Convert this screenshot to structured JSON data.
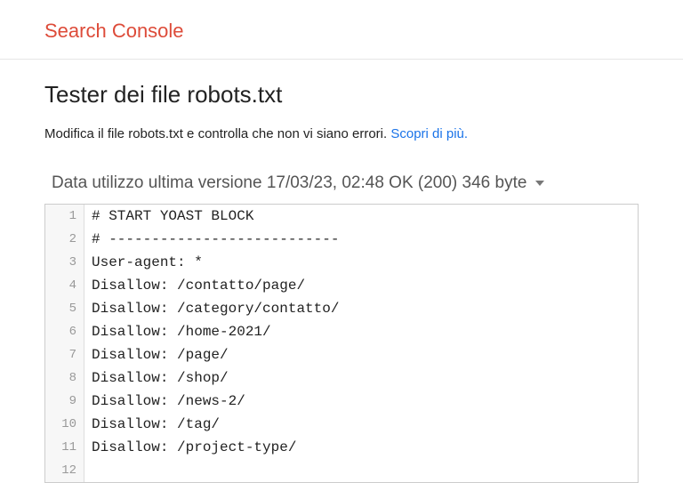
{
  "header": {
    "title": "Search Console"
  },
  "page": {
    "title": "Tester dei file robots.txt",
    "subtitle": "Modifica il file robots.txt e controlla che non vi siano errori. ",
    "learn_more": "Scopri di più."
  },
  "status": {
    "text": "Data utilizzo ultima versione 17/03/23, 02:48 OK (200) 346 byte"
  },
  "editor": {
    "lines": [
      "# START YOAST BLOCK",
      "# ---------------------------",
      "User-agent: *",
      "Disallow: /contatto/page/",
      "Disallow: /category/contatto/",
      "Disallow: /home-2021/",
      "Disallow: /page/",
      "Disallow: /shop/",
      "Disallow: /news-2/",
      "Disallow: /tag/",
      "Disallow: /project-type/",
      ""
    ]
  }
}
